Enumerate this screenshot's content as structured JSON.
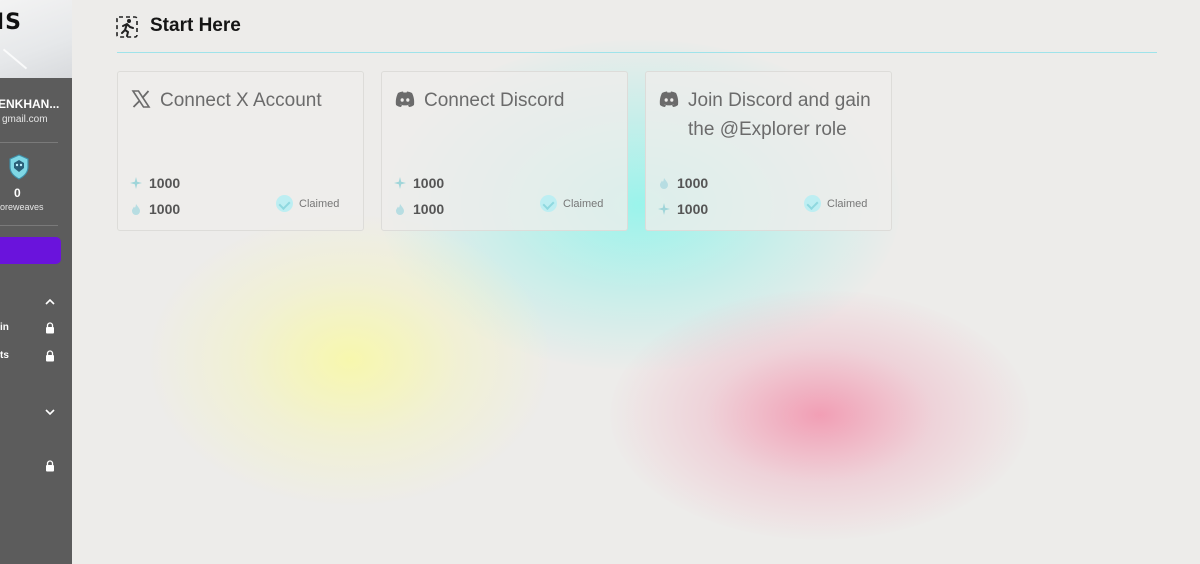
{
  "sidebar": {
    "logo_text": "IS",
    "user": {
      "name": "ENKHAN...",
      "email": "gmail.com"
    },
    "score": "0",
    "score_label": "oreweaves",
    "menu": [
      {
        "label": "",
        "chevron": "up"
      },
      {
        "label": "in",
        "locked": true
      },
      {
        "label": "ts",
        "locked": true
      },
      {
        "label": "",
        "chevron": "down"
      },
      {
        "label": "",
        "locked": true
      }
    ]
  },
  "header": {
    "title": "Start Here",
    "icon": "running-person-icon"
  },
  "cards": [
    {
      "icon": "x-logo-icon",
      "title": "Connect X Account",
      "rewards": [
        {
          "icon": "sparkle-icon",
          "value": "1000"
        },
        {
          "icon": "flame-icon",
          "value": "1000"
        }
      ],
      "status": "Claimed"
    },
    {
      "icon": "discord-icon",
      "title": "Connect Discord",
      "rewards": [
        {
          "icon": "sparkle-icon",
          "value": "1000"
        },
        {
          "icon": "flame-icon",
          "value": "1000"
        }
      ],
      "status": "Claimed"
    },
    {
      "icon": "discord-icon",
      "title": "Join Discord and gain the @Explorer role",
      "rewards": [
        {
          "icon": "flame-icon",
          "value": "1000"
        },
        {
          "icon": "sparkle-icon",
          "value": "1000"
        }
      ],
      "status": "Claimed"
    }
  ],
  "colors": {
    "accent_purple": "#6a13dc",
    "sidebar_dark": "#5c5c5c",
    "header_rule": "#9fe3ea",
    "claimed_check": "#bdeef2"
  }
}
